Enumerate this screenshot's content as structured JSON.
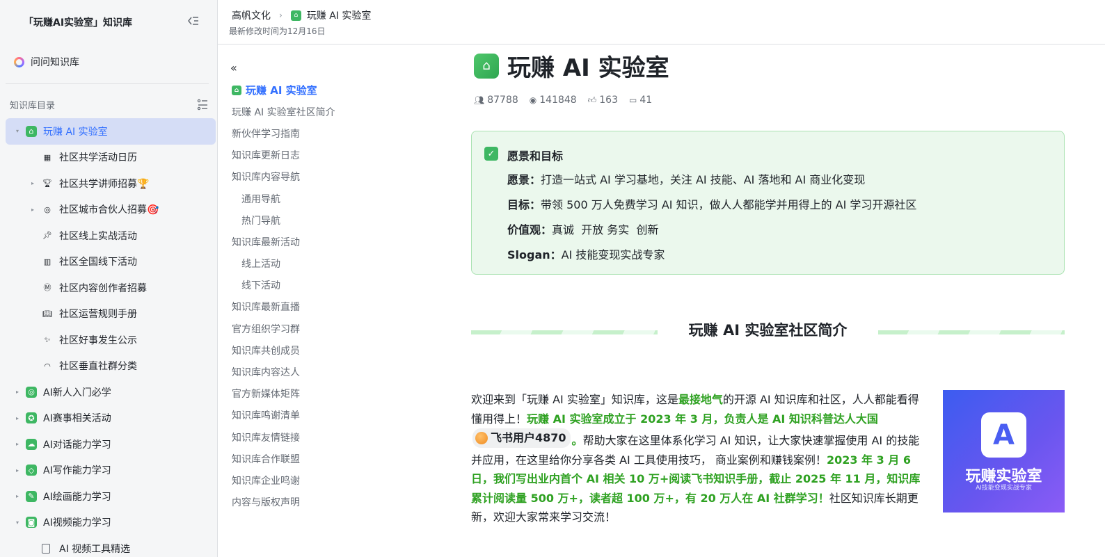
{
  "sidebar": {
    "title": "「玩赚AI实验室」知识库",
    "ask": "问问知识库",
    "directory_label": "知识库目录",
    "items": [
      {
        "label": "玩赚 AI 实验室",
        "level": 0,
        "caret": "▾",
        "icon": "home-icon",
        "active": true
      },
      {
        "label": "社区共学活动日历",
        "level": 1,
        "caret": "",
        "icon": "calendar-icon"
      },
      {
        "label": "社区共学讲师招募🏆",
        "level": 1,
        "caret": "▸",
        "icon": "trophy-icon"
      },
      {
        "label": "社区城市合伙人招募🎯",
        "level": 1,
        "caret": "▸",
        "icon": "target-icon"
      },
      {
        "label": "社区线上实战活动",
        "level": 1,
        "caret": "",
        "icon": "pin-icon"
      },
      {
        "label": "社区全国线下活动",
        "level": 1,
        "caret": "",
        "icon": "building-icon"
      },
      {
        "label": "社区内容创作者招募",
        "level": 1,
        "caret": "",
        "icon": "m-badge-icon"
      },
      {
        "label": "社区运营规则手册",
        "level": 1,
        "caret": "",
        "icon": "book-icon"
      },
      {
        "label": "社区好事发生公示",
        "level": 1,
        "caret": "",
        "icon": "sparkles-icon"
      },
      {
        "label": "社区垂直社群分类",
        "level": 1,
        "caret": "",
        "icon": "rainbow-icon"
      },
      {
        "label": "AI新人入门必学",
        "level": 0,
        "caret": "▸",
        "icon": "compass-icon"
      },
      {
        "label": "AI赛事相关活动",
        "level": 0,
        "caret": "▸",
        "icon": "badge-icon"
      },
      {
        "label": "AI对话能力学习",
        "level": 0,
        "caret": "▸",
        "icon": "cloud-icon"
      },
      {
        "label": "AI写作能力学习",
        "level": 0,
        "caret": "▸",
        "icon": "tag-icon"
      },
      {
        "label": "AI绘画能力学习",
        "level": 0,
        "caret": "▸",
        "icon": "edit-icon"
      },
      {
        "label": "AI视频能力学习",
        "level": 0,
        "caret": "▾",
        "icon": "camera-icon"
      },
      {
        "label": "AI 视频工具精选",
        "level": 1,
        "caret": "",
        "icon": "doc-icon"
      }
    ]
  },
  "topbar": {
    "crumb_parent": "高帆文化",
    "crumb_current": "玩赚 AI 实验室",
    "modified": "最新修改时间为12月16日"
  },
  "toc": {
    "items": [
      {
        "label": "玩赚 AI 实验室",
        "kind": "current"
      },
      {
        "label": "玩赚 AI 实验室社区简介",
        "kind": "top"
      },
      {
        "label": "新伙伴学习指南",
        "kind": "top"
      },
      {
        "label": "知识库更新日志",
        "kind": "top"
      },
      {
        "label": "知识库内容导航",
        "kind": "top"
      },
      {
        "label": "通用导航",
        "kind": "sub"
      },
      {
        "label": "热门导航",
        "kind": "sub"
      },
      {
        "label": "知识库最新活动",
        "kind": "top"
      },
      {
        "label": "线上活动",
        "kind": "sub"
      },
      {
        "label": "线下活动",
        "kind": "sub"
      },
      {
        "label": "知识库最新直播",
        "kind": "top"
      },
      {
        "label": "官方组织学习群",
        "kind": "top"
      },
      {
        "label": "知识库共创成员",
        "kind": "top"
      },
      {
        "label": "知识库内容达人",
        "kind": "top"
      },
      {
        "label": "官方新媒体矩阵",
        "kind": "top"
      },
      {
        "label": "知识库鸣谢清单",
        "kind": "top"
      },
      {
        "label": "知识库友情链接",
        "kind": "top"
      },
      {
        "label": "知识库合作联盟",
        "kind": "top"
      },
      {
        "label": "知识库企业鸣谢",
        "kind": "top"
      },
      {
        "label": "内容与版权声明",
        "kind": "top"
      }
    ]
  },
  "doc": {
    "title": "玩赚 AI 实验室",
    "stats": {
      "members": "87788",
      "views": "141848",
      "likes": "163",
      "comments": "41"
    },
    "callout": {
      "heading": "愿景和目标",
      "lines": [
        {
          "key": "愿景：",
          "text": "打造一站式 AI 学习基地，关注 AI 技能、AI 落地和 AI 商业化变现"
        },
        {
          "key": "目标：",
          "text": "带领 500 万人免费学习 AI 知识，做人人都能学并用得上的 AI 学习开源社区"
        },
        {
          "key": "价值观：",
          "text": "真诚  开放 务实  创新"
        },
        {
          "key": "Slogan：",
          "text": "AI 技能变现实战专家"
        }
      ]
    },
    "section_title": "玩赚 AI 实验室社区简介",
    "intro": {
      "p1": "欢迎来到「玩赚 AI 实验室」知识库，这是",
      "h1": "最接地气",
      "p2": "的开源 AI 知识库和社区，人人都能看得懂用得上！",
      "h2": "玩赚 AI 实验室成立于 2023 年 3 月，负责人是 AI 知识科普达人大国",
      "mention": "飞书用户4870",
      "h3": "。",
      "p3": "帮助大家在这里体系化学习 AI 知识，让大家快速掌握使用 AI 的技能并应用，在这里给你分享各类 AI 工具使用技巧， 商业案例和赚钱案例！",
      "h4": "2023 年 3 月 6 日，我们写出业内首个 AI 相关 10 万+阅读飞书知识手册，截止 2025 年 11 月，知识库累计阅读量 500 万+，读者超 100 万+，有 20 万人在 AI 社群学习！",
      "p4": "社区知识库长期更新，欢迎大家常来学习交流！"
    },
    "logo": {
      "mark": "A",
      "name": "玩赚实验室",
      "tagline": "AI技能变现实战专家"
    }
  },
  "colors": {
    "accent": "#3370ff",
    "green": "#2ea121",
    "callout_bg": "#ebf8ed",
    "active_bg": "#d5ddf6"
  }
}
